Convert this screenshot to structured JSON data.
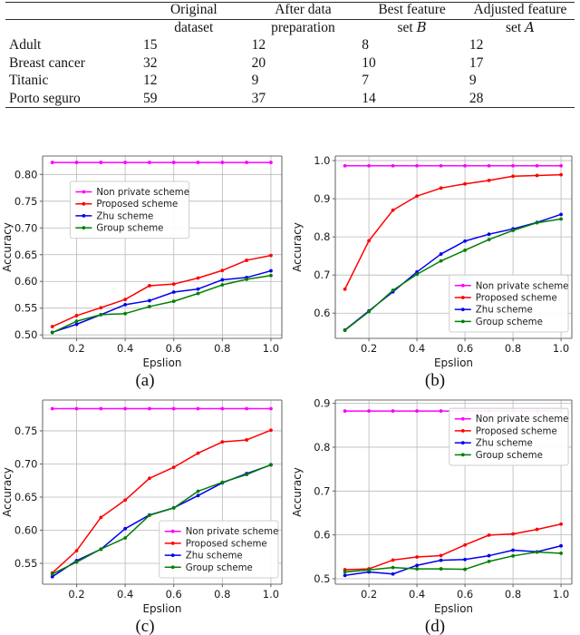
{
  "table": {
    "columns": [
      "",
      "Original dataset",
      "After data preparation",
      "Best feature set ℬ",
      "Adjusted feature set 𝒜"
    ],
    "header_lines": [
      {
        "l1": "",
        "l2": ""
      },
      {
        "l1": "Original",
        "l2": "dataset"
      },
      {
        "l1": "After data",
        "l2": "preparation"
      },
      {
        "l1": "Best feature",
        "l2_pre": "set ",
        "l2_sym": "B"
      },
      {
        "l1": "Adjusted feature",
        "l2_pre": "set ",
        "l2_sym": "A"
      }
    ],
    "rows": [
      {
        "name": "Adult",
        "original": "15",
        "after": "12",
        "best": "8",
        "adjusted": "12"
      },
      {
        "name": "Breast cancer",
        "original": "32",
        "after": "20",
        "best": "10",
        "adjusted": "17"
      },
      {
        "name": "Titanic",
        "original": "12",
        "after": "9",
        "best": "7",
        "adjusted": "9"
      },
      {
        "name": "Porto seguro",
        "original": "59",
        "after": "37",
        "best": "14",
        "adjusted": "28"
      }
    ]
  },
  "series_colors": {
    "non_private": "#ff00ff",
    "proposed": "#ff0000",
    "zhu": "#0000ee",
    "group": "#008000"
  },
  "legend_labels": {
    "non_private": "Non private scheme",
    "proposed": "Proposed scheme",
    "zhu": "Zhu scheme",
    "group": "Group scheme"
  },
  "chart_data": [
    {
      "id": "a",
      "type": "line",
      "caption": "(a)",
      "xlabel": "Epslion",
      "ylabel": "Accuracy",
      "x": [
        0.1,
        0.2,
        0.3,
        0.4,
        0.5,
        0.6,
        0.7,
        0.8,
        0.9,
        1.0
      ],
      "xticks": [
        0.2,
        0.4,
        0.6,
        0.8,
        1.0
      ],
      "xticklabels": [
        "0.2",
        "0.4",
        "0.6",
        "0.8",
        "1.0"
      ],
      "yticks": [
        0.5,
        0.55,
        0.6,
        0.65,
        0.7,
        0.75,
        0.8
      ],
      "yticklabels": [
        "0.50",
        "0.55",
        "0.60",
        "0.65",
        "0.70",
        "0.75",
        "0.80"
      ],
      "xlim": [
        0.06,
        1.045
      ],
      "ylim": [
        0.4935,
        0.8345
      ],
      "grid": true,
      "legend_position": "center-left",
      "series": [
        {
          "name": "Non private scheme",
          "key": "non_private",
          "values": [
            0.8225,
            0.8225,
            0.8225,
            0.8225,
            0.8225,
            0.8225,
            0.8225,
            0.8225,
            0.8225,
            0.8225
          ]
        },
        {
          "name": "Proposed scheme",
          "key": "proposed",
          "values": [
            0.5155,
            0.536,
            0.5508,
            0.5663,
            0.592,
            0.595,
            0.6063,
            0.6205,
            0.6395,
            0.6485
          ]
        },
        {
          "name": "Zhu scheme",
          "key": "zhu",
          "values": [
            0.5048,
            0.5198,
            0.5378,
            0.5565,
            0.564,
            0.58,
            0.5858,
            0.603,
            0.6073,
            0.6198
          ]
        },
        {
          "name": "Group scheme",
          "key": "group",
          "values": [
            0.5043,
            0.5255,
            0.5378,
            0.5398,
            0.553,
            0.5628,
            0.5775,
            0.5935,
            0.604,
            0.611
          ]
        }
      ]
    },
    {
      "id": "b",
      "type": "line",
      "caption": "(b)",
      "xlabel": "Epslion",
      "ylabel": "Accuracy",
      "x": [
        0.1,
        0.2,
        0.3,
        0.4,
        0.5,
        0.6,
        0.7,
        0.8,
        0.9,
        1.0
      ],
      "xticks": [
        0.2,
        0.4,
        0.6,
        0.8,
        1.0
      ],
      "xticklabels": [
        "0.2",
        "0.4",
        "0.6",
        "0.8",
        "1.0"
      ],
      "yticks": [
        0.6,
        0.7,
        0.8,
        0.9,
        1.0
      ],
      "yticklabels": [
        "0.6",
        "0.7",
        "0.8",
        "0.9",
        "1.0"
      ],
      "xlim": [
        0.06,
        1.045
      ],
      "ylim": [
        0.534,
        1.012
      ],
      "grid": true,
      "legend_position": "lower-right",
      "series": [
        {
          "name": "Non private scheme",
          "key": "non_private",
          "values": [
            0.9865,
            0.9865,
            0.9865,
            0.9865,
            0.9865,
            0.9865,
            0.9865,
            0.9865,
            0.9865,
            0.9865
          ]
        },
        {
          "name": "Proposed scheme",
          "key": "proposed",
          "values": [
            0.663,
            0.79,
            0.87,
            0.907,
            0.928,
            0.939,
            0.948,
            0.959,
            0.961,
            0.963
          ]
        },
        {
          "name": "Zhu scheme",
          "key": "zhu",
          "values": [
            0.556,
            0.606,
            0.656,
            0.708,
            0.755,
            0.789,
            0.807,
            0.821,
            0.838,
            0.859
          ]
        },
        {
          "name": "Group scheme",
          "key": "group",
          "values": [
            0.555,
            0.604,
            0.66,
            0.702,
            0.737,
            0.765,
            0.793,
            0.817,
            0.837,
            0.847
          ]
        }
      ]
    },
    {
      "id": "c",
      "type": "line",
      "caption": "(c)",
      "xlabel": "Epslion",
      "ylabel": "Accuracy",
      "x": [
        0.1,
        0.2,
        0.3,
        0.4,
        0.5,
        0.6,
        0.7,
        0.8,
        0.9,
        1.0
      ],
      "xticks": [
        0.2,
        0.4,
        0.6,
        0.8,
        1.0
      ],
      "xticklabels": [
        "0.2",
        "0.4",
        "0.6",
        "0.8",
        "1.0"
      ],
      "yticks": [
        0.55,
        0.6,
        0.65,
        0.7,
        0.75
      ],
      "yticklabels": [
        "0.55",
        "0.60",
        "0.65",
        "0.70",
        "0.75"
      ],
      "xlim": [
        0.06,
        1.045
      ],
      "ylim": [
        0.5185,
        0.7965
      ],
      "grid": true,
      "legend_position": "lower-right",
      "series": [
        {
          "name": "Non private scheme",
          "key": "non_private",
          "values": [
            0.7835,
            0.7835,
            0.7835,
            0.7835,
            0.7835,
            0.7835,
            0.7835,
            0.7835,
            0.7835,
            0.7835
          ]
        },
        {
          "name": "Proposed scheme",
          "key": "proposed",
          "values": [
            0.5355,
            0.569,
            0.6193,
            0.6455,
            0.6783,
            0.695,
            0.7163,
            0.7333,
            0.7363,
            0.751
          ]
        },
        {
          "name": "Zhu scheme",
          "key": "zhu",
          "values": [
            0.5298,
            0.554,
            0.5713,
            0.6023,
            0.623,
            0.6338,
            0.6523,
            0.6715,
            0.6855,
            0.6985
          ]
        },
        {
          "name": "Group scheme",
          "key": "group",
          "values": [
            0.534,
            0.5518,
            0.5715,
            0.5883,
            0.6225,
            0.6335,
            0.6588,
            0.6723,
            0.684,
            0.699
          ]
        }
      ]
    },
    {
      "id": "d",
      "type": "line",
      "caption": "(d)",
      "xlabel": "Epslion",
      "ylabel": "Accuracy",
      "x": [
        0.1,
        0.2,
        0.3,
        0.4,
        0.5,
        0.6,
        0.7,
        0.8,
        0.9,
        1.0
      ],
      "xticks": [
        0.2,
        0.4,
        0.6,
        0.8,
        1.0
      ],
      "xticklabels": [
        "0.2",
        "0.4",
        "0.6",
        "0.8",
        "1.0"
      ],
      "yticks": [
        0.5,
        0.6,
        0.7,
        0.8,
        0.9
      ],
      "yticklabels": [
        "0.5",
        "0.6",
        "0.7",
        "0.8",
        "0.9"
      ],
      "xlim": [
        0.06,
        1.045
      ],
      "ylim": [
        0.4875,
        0.9075
      ],
      "grid": true,
      "legend_position": "upper-right",
      "series": [
        {
          "name": "Non private scheme",
          "key": "non_private",
          "values": [
            0.8825,
            0.8825,
            0.8825,
            0.8825,
            0.8825,
            0.8825,
            0.8825,
            0.8825,
            0.8825,
            0.8825
          ]
        },
        {
          "name": "Proposed scheme",
          "key": "proposed",
          "values": [
            0.5205,
            0.5225,
            0.5425,
            0.5495,
            0.5528,
            0.577,
            0.5995,
            0.602,
            0.6125,
            0.6245
          ]
        },
        {
          "name": "Zhu scheme",
          "key": "zhu",
          "values": [
            0.5075,
            0.5155,
            0.5108,
            0.5305,
            0.542,
            0.5438,
            0.5525,
            0.565,
            0.5615,
            0.575
          ]
        },
        {
          "name": "Group scheme",
          "key": "group",
          "values": [
            0.5155,
            0.52,
            0.5255,
            0.5225,
            0.5225,
            0.5215,
            0.5395,
            0.552,
            0.5608,
            0.558
          ]
        }
      ]
    }
  ]
}
